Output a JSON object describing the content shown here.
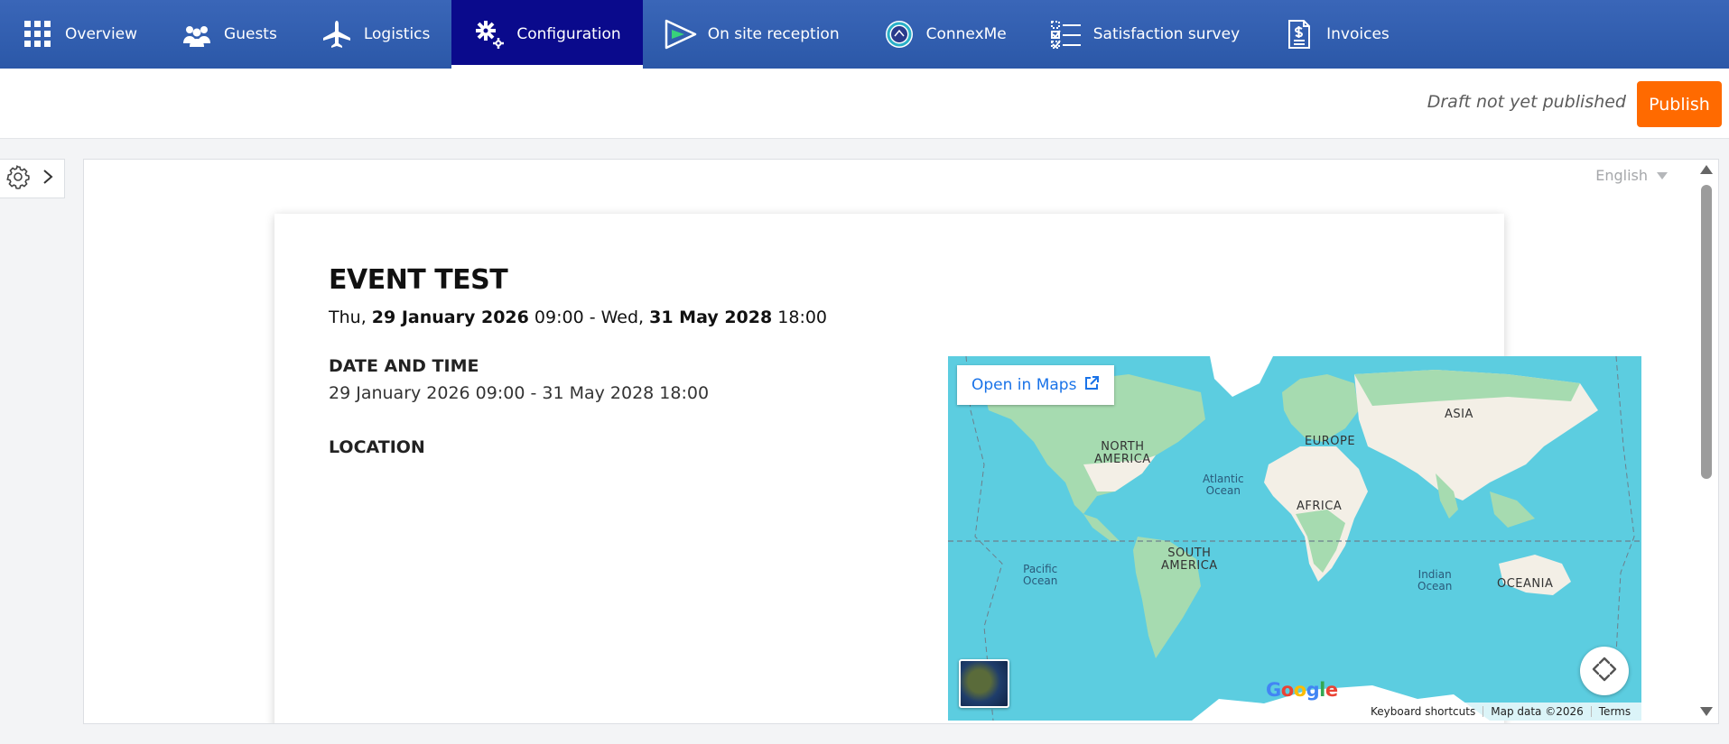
{
  "nav": {
    "items": [
      {
        "label": "Overview",
        "icon": "grid-icon"
      },
      {
        "label": "Guests",
        "icon": "users-icon"
      },
      {
        "label": "Logistics",
        "icon": "airplane-icon"
      },
      {
        "label": "Configuration",
        "icon": "gears-icon",
        "active": true
      },
      {
        "label": "On site reception",
        "icon": "play-triangle-icon"
      },
      {
        "label": "ConnexMe",
        "icon": "connexme-icon"
      },
      {
        "label": "Satisfaction survey",
        "icon": "checklist-icon"
      },
      {
        "label": "Invoices",
        "icon": "invoice-icon"
      }
    ]
  },
  "actionbar": {
    "status": "Draft not yet published",
    "publish_label": "Publish",
    "publish_color": "#ff6a00"
  },
  "preview": {
    "language": "English",
    "event": {
      "title": "EVENT TEST",
      "dates": {
        "start_day": "Thu,",
        "start_date": "29 January 2026",
        "start_time": "09:00",
        "separator": "- Wed,",
        "end_date": "31 May 2028",
        "end_time": "18:00"
      },
      "date_time_heading": "DATE AND TIME",
      "date_time_value": "29 January 2026 09:00 - 31 May 2028 18:00",
      "location_heading": "LOCATION"
    },
    "map": {
      "open_label": "Open in Maps",
      "labels": {
        "north_america": "NORTH\nAMERICA",
        "europe": "EUROPE",
        "asia": "ASIA",
        "africa": "AFRICA",
        "south_america": "SOUTH\nAMERICA",
        "oceania": "OCEANIA",
        "atlantic": "Atlantic\nOcean",
        "pacific": "Pacific\nOcean",
        "indian": "Indian\nOcean"
      },
      "footer": {
        "shortcuts": "Keyboard shortcuts",
        "data": "Map data ©2026",
        "terms": "Terms"
      },
      "google": "Google"
    }
  }
}
